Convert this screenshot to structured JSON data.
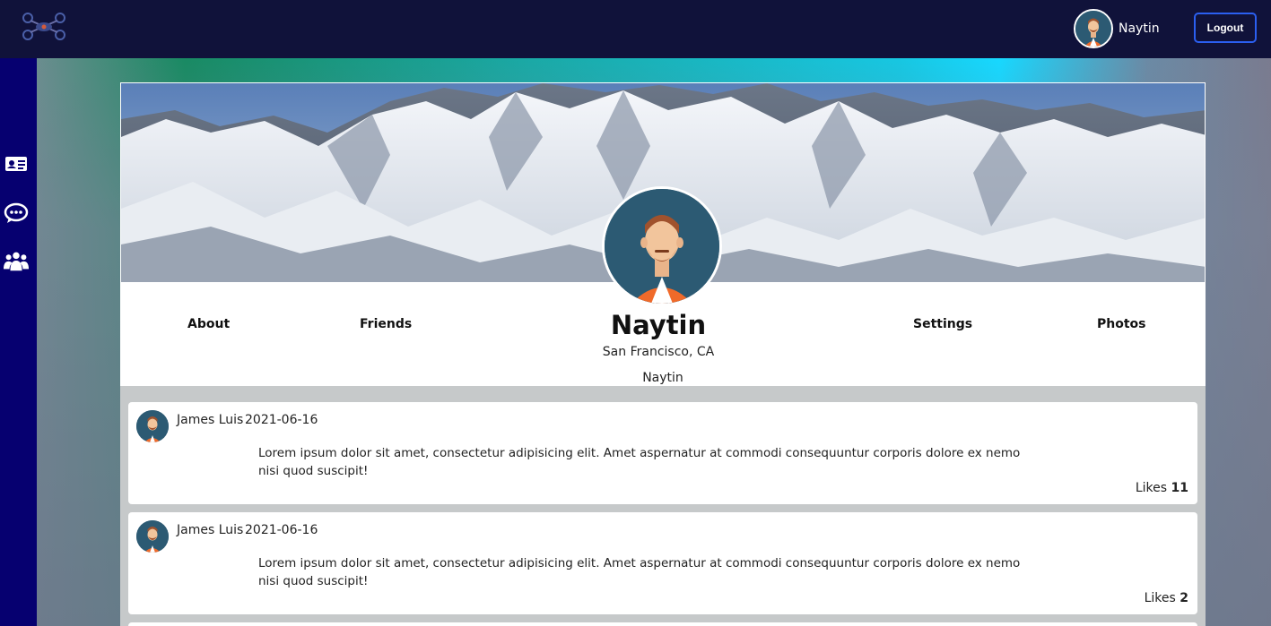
{
  "header": {
    "logo_icon": "drone-logo-icon",
    "user_name": "Naytin",
    "logout_label": "Logout"
  },
  "sidebar": {
    "items": [
      {
        "icon": "id-card-icon"
      },
      {
        "icon": "chat-bubble-icon"
      },
      {
        "icon": "users-group-icon"
      }
    ]
  },
  "profile": {
    "name": "Naytin",
    "location": "San Francisco, CA",
    "username": "Naytin",
    "tabs": [
      "About",
      "Friends",
      "Settings",
      "Photos"
    ]
  },
  "posts": [
    {
      "author": "James Luis",
      "date": "2021-06-16",
      "text": "Lorem ipsum dolor sit amet, consectetur adipisicing elit. Amet aspernatur at commodi consequuntur corporis dolore ex nemo nisi quod suscipit!",
      "likes_label": "Likes",
      "likes": "11"
    },
    {
      "author": "James Luis",
      "date": "2021-06-16",
      "text": "Lorem ipsum dolor sit amet, consectetur adipisicing elit. Amet aspernatur at commodi consequuntur corporis dolore ex nemo nisi quod suscipit!",
      "likes_label": "Likes",
      "likes": "2"
    }
  ],
  "colors": {
    "topbar": "#10123a",
    "sidebar": "#060070",
    "logout_border": "#2b5ff0"
  }
}
